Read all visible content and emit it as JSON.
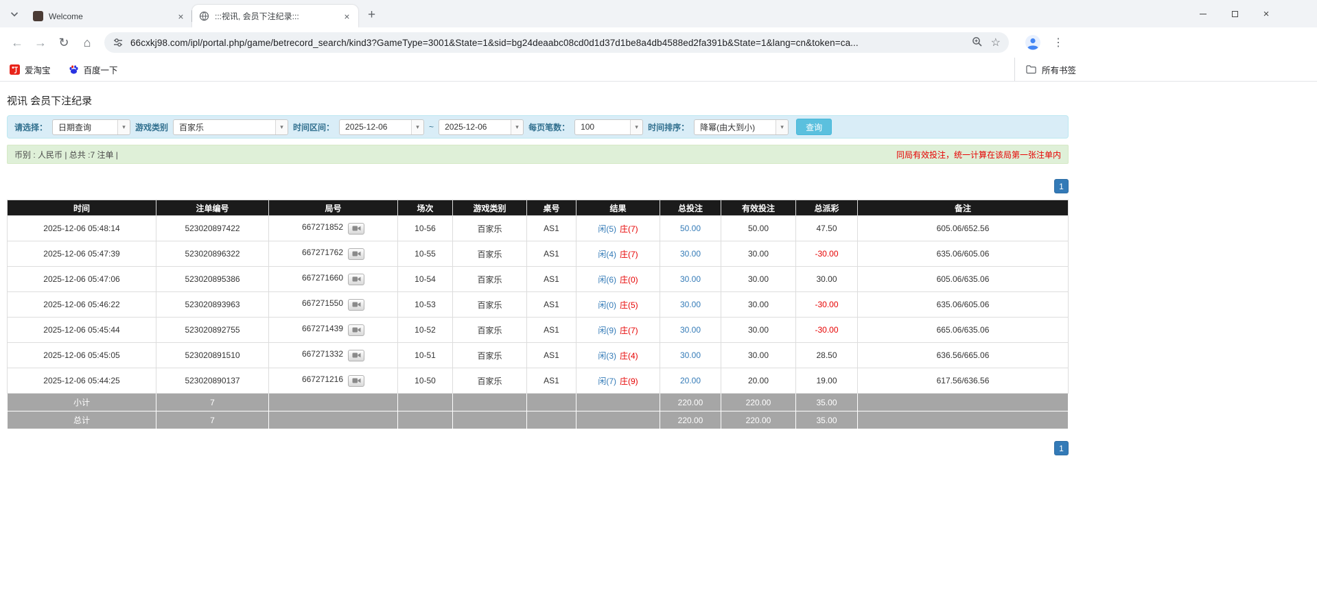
{
  "colors": {
    "accent_blue": "#337ab7",
    "negative_red": "#e60000",
    "player_blue": "#337ab7",
    "banker_red": "#e60000",
    "search_button_bg": "#5bc0de",
    "filter_panel_bg": "#d9edf7",
    "summary_bar_bg": "#dff0d8",
    "table_header_bg": "#1b1b1b",
    "table_footer_bg": "#a6a6a6",
    "pagination_bg": "#337ab7"
  },
  "icons": {
    "close": "×",
    "new_tab": "+",
    "back": "←",
    "forward": "→",
    "refresh": "↻",
    "home": "⌂",
    "star": "☆",
    "menu_dots": "⋮",
    "combo_arrow": "▾"
  },
  "browser": {
    "tabs": [
      {
        "title": "Welcome"
      },
      {
        "title": ":::视讯, 会员下注纪录:::"
      }
    ],
    "url": "66cxkj98.com/ipl/portal.php/game/betrecord_search/kind3?GameType=3001&State=1&sid=bg24deaabc08cd0d1d37d1be8a4db4588ed2fa391b&State=1&lang=cn&token=ca...",
    "bookmarks": [
      {
        "label": "爱淘宝"
      },
      {
        "label": "百度一下"
      }
    ],
    "all_bookmarks_label": "所有书签"
  },
  "page": {
    "title": "视讯 会员下注纪录",
    "filters": {
      "select_label": "请选择：",
      "select_value": "日期查询",
      "game_type_label": "游戏类别",
      "game_type_value": "百家乐",
      "date_range_label": "时间区间：",
      "date_from": "2025-12-06",
      "date_separator": "~",
      "date_to": "2025-12-06",
      "page_size_label": "每页笔数：",
      "page_size_value": "100",
      "sort_label": "时间排序：",
      "sort_value": "降幂(由大到小)",
      "search_button": "查询"
    },
    "summary": {
      "left": "币别 : 人民币 | 总共 :7 注单 |",
      "note": "同局有效投注，统一计算在该局第一张注单内"
    },
    "pagination": {
      "current": "1"
    },
    "table": {
      "headers": [
        "时间",
        "注单编号",
        "局号",
        "场次",
        "游戏类别",
        "桌号",
        "结果",
        "总投注",
        "有效投注",
        "总派彩",
        "备注"
      ],
      "rows": [
        {
          "time": "2025-12-06 05:48:14",
          "bet_id": "523020897422",
          "round_id": "667271852",
          "session": "10-56",
          "game": "百家乐",
          "table_no": "AS1",
          "result_player": "闲(5)",
          "result_banker": "庄(7)",
          "total_bet": "50.00",
          "valid_bet": "50.00",
          "payout": "47.50",
          "remark": "605.06/652.56"
        },
        {
          "time": "2025-12-06 05:47:39",
          "bet_id": "523020896322",
          "round_id": "667271762",
          "session": "10-55",
          "game": "百家乐",
          "table_no": "AS1",
          "result_player": "闲(4)",
          "result_banker": "庄(7)",
          "total_bet": "30.00",
          "valid_bet": "30.00",
          "payout": "-30.00",
          "remark": "635.06/605.06"
        },
        {
          "time": "2025-12-06 05:47:06",
          "bet_id": "523020895386",
          "round_id": "667271660",
          "session": "10-54",
          "game": "百家乐",
          "table_no": "AS1",
          "result_player": "闲(6)",
          "result_banker": "庄(0)",
          "total_bet": "30.00",
          "valid_bet": "30.00",
          "payout": "30.00",
          "remark": "605.06/635.06"
        },
        {
          "time": "2025-12-06 05:46:22",
          "bet_id": "523020893963",
          "round_id": "667271550",
          "session": "10-53",
          "game": "百家乐",
          "table_no": "AS1",
          "result_player": "闲(0)",
          "result_banker": "庄(5)",
          "total_bet": "30.00",
          "valid_bet": "30.00",
          "payout": "-30.00",
          "remark": "635.06/605.06"
        },
        {
          "time": "2025-12-06 05:45:44",
          "bet_id": "523020892755",
          "round_id": "667271439",
          "session": "10-52",
          "game": "百家乐",
          "table_no": "AS1",
          "result_player": "闲(9)",
          "result_banker": "庄(7)",
          "total_bet": "30.00",
          "valid_bet": "30.00",
          "payout": "-30.00",
          "remark": "665.06/635.06"
        },
        {
          "time": "2025-12-06 05:45:05",
          "bet_id": "523020891510",
          "round_id": "667271332",
          "session": "10-51",
          "game": "百家乐",
          "table_no": "AS1",
          "result_player": "闲(3)",
          "result_banker": "庄(4)",
          "total_bet": "30.00",
          "valid_bet": "30.00",
          "payout": "28.50",
          "remark": "636.56/665.06"
        },
        {
          "time": "2025-12-06 05:44:25",
          "bet_id": "523020890137",
          "round_id": "667271216",
          "session": "10-50",
          "game": "百家乐",
          "table_no": "AS1",
          "result_player": "闲(7)",
          "result_banker": "庄(9)",
          "total_bet": "20.00",
          "valid_bet": "20.00",
          "payout": "19.00",
          "remark": "617.56/636.56"
        }
      ],
      "subtotal": {
        "label": "小计",
        "count": "7",
        "total_bet": "220.00",
        "valid_bet": "220.00",
        "payout": "35.00"
      },
      "grand_total": {
        "label": "总计",
        "count": "7",
        "total_bet": "220.00",
        "valid_bet": "220.00",
        "payout": "35.00"
      }
    }
  }
}
